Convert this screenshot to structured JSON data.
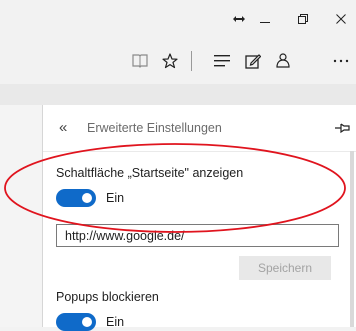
{
  "window": {
    "restore_down_glyph": "↔",
    "minimize_glyph": "–",
    "maximize_glyph": "▫",
    "close_glyph": "✕"
  },
  "toolbar": {
    "icons": [
      "reading-view-icon",
      "favorites-star-icon",
      "hub-icon",
      "web-note-icon",
      "share-icon",
      "more-icon"
    ]
  },
  "panel": {
    "back_glyph": "«",
    "title": "Erweiterte Einstellungen",
    "pin_icon": "pin-icon"
  },
  "home_button": {
    "label": "Schaltfläche „Startseite\" anzeigen",
    "state": "Ein",
    "enabled": true,
    "url": "http://www.google.de/",
    "save_label": "Speichern"
  },
  "popups": {
    "label": "Popups blockieren",
    "state": "Ein",
    "enabled": true
  },
  "colors": {
    "accent": "#0f6ac9",
    "annotation": "#e0141e"
  }
}
